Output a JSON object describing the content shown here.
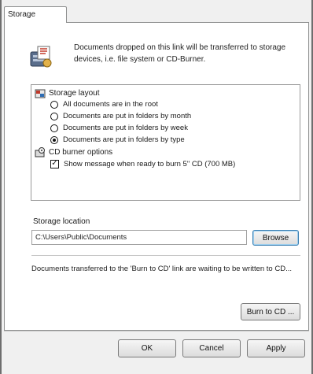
{
  "tab": {
    "label": "Storage"
  },
  "description": "Documents dropped on this link will be transferred to storage devices, i.e. file system or CD-Burner.",
  "options": {
    "storage_layout_label": "Storage layout",
    "radios": [
      {
        "label": "All documents are in the root",
        "selected": false
      },
      {
        "label": "Documents are put in folders by month",
        "selected": false
      },
      {
        "label": "Documents are put in folders by week",
        "selected": false
      },
      {
        "label": "Documents are put in folders by type",
        "selected": true
      }
    ],
    "cd_burner_label": "CD burner options",
    "show_message_label": "Show message when ready to burn 5\" CD (700 MB)",
    "show_message_checked": true
  },
  "storage_location": {
    "label": "Storage location",
    "path": "C:\\Users\\Public\\Documents",
    "browse_label": "Browse"
  },
  "burn": {
    "note": "Documents transferred to the 'Burn to CD' link are waiting to be written to CD...",
    "button_label": "Burn to CD ..."
  },
  "footer": {
    "ok_label": "OK",
    "cancel_label": "Cancel",
    "apply_label": "Apply"
  }
}
